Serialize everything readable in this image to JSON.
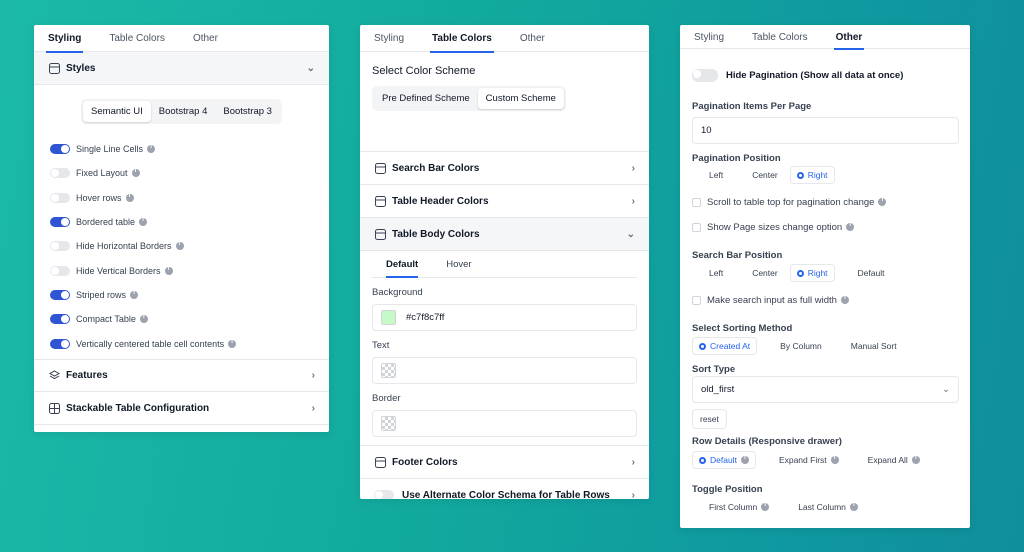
{
  "panel1": {
    "tabs": [
      "Styling",
      "Table Colors",
      "Other"
    ],
    "styles_header": "Styles",
    "frameworks": [
      "Semantic UI",
      "Bootstrap 4",
      "Bootstrap 3"
    ],
    "toggles": [
      {
        "label": "Single Line Cells",
        "on": true
      },
      {
        "label": "Fixed Layout",
        "on": false
      },
      {
        "label": "Hover rows",
        "on": false
      },
      {
        "label": "Bordered table",
        "on": true
      },
      {
        "label": "Hide Horizontal Borders",
        "on": false
      },
      {
        "label": "Hide Vertical Borders",
        "on": false
      },
      {
        "label": "Striped rows",
        "on": true
      },
      {
        "label": "Compact Table",
        "on": true
      },
      {
        "label": "Vertically centered table cell contents",
        "on": true
      }
    ],
    "features": "Features",
    "stackable": "Stackable Table Configuration"
  },
  "panel2": {
    "tabs": [
      "Styling",
      "Table Colors",
      "Other"
    ],
    "scheme_title": "Select Color Scheme",
    "scheme_options": [
      "Pre Defined Scheme",
      "Custom Scheme"
    ],
    "search_bar": "Search Bar Colors",
    "header_colors": "Table Header Colors",
    "body_colors": "Table Body Colors",
    "sub_tabs": [
      "Default",
      "Hover"
    ],
    "background_label": "Background",
    "background_value": "#c7f8c7ff",
    "background_color": "#c7f8c7",
    "text_label": "Text",
    "border_label": "Border",
    "footer_colors": "Footer Colors",
    "alternate": "Use Alternate Color Schema for Table Rows"
  },
  "panel3": {
    "tabs": [
      "Styling",
      "Table Colors",
      "Other"
    ],
    "hide_pagination": "Hide Pagination (Show all data at once)",
    "items_per_page_label": "Pagination Items Per Page",
    "items_per_page": "10",
    "pagination_position_label": "Pagination Position",
    "pagination_positions": [
      "Left",
      "Center",
      "Right"
    ],
    "scroll_top": "Scroll to table top for pagination change",
    "page_sizes": "Show Page sizes change option",
    "search_position_label": "Search Bar Position",
    "search_positions": [
      "Left",
      "Center",
      "Right",
      "Default"
    ],
    "full_width": "Make search input as full width",
    "sorting_label": "Select Sorting Method",
    "sorting_options": [
      "Created At",
      "By Column",
      "Manual Sort"
    ],
    "sort_type_label": "Sort Type",
    "sort_type": "old_first",
    "reset": "reset",
    "row_details_label": "Row Details (Responsive drawer)",
    "row_details": [
      "Default",
      "Expand First",
      "Expand All"
    ],
    "toggle_position_label": "Toggle Position",
    "toggle_positions": [
      "First Column",
      "Last Column"
    ]
  },
  "accent": "#2563eb"
}
